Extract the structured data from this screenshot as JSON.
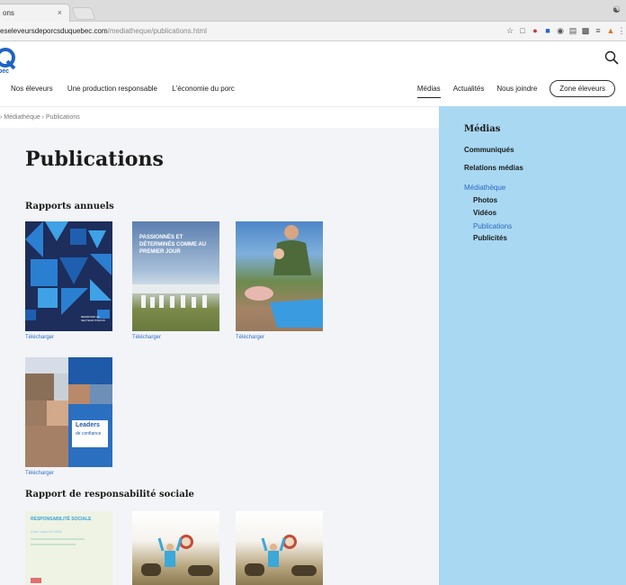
{
  "browser": {
    "tab_title": "ons",
    "tab_close": "×",
    "url_host": "eseleveursdeporcsduquebec.com",
    "url_path": "/mediatheque/publications.html"
  },
  "header": {
    "logo_text": "bec",
    "nav_left": [
      "Nos éleveurs",
      "Une production responsable",
      "L'économie du porc"
    ],
    "nav_right": [
      "Médias",
      "Actualités",
      "Nous joindre"
    ],
    "zone_button": "Zone éleveurs"
  },
  "breadcrumb": "› Médiathèque  ›  Publications",
  "main": {
    "title": "Publications",
    "section_annual": "Rapports annuels",
    "section_social": "Rapport de responsabilité sociale",
    "download_label": "Télécharger",
    "cover_texts": {
      "report1_small": "REDÉFINIR LE SECTEUR PORCIN",
      "report2_head": "PASSIONNÉS ET DÉTERMINÉS COMME AU PREMIER JOUR",
      "report4_head": "Leaders",
      "report4_sub": "de confiance",
      "social1_head": "RESPONSABILITÉ SOCIALE",
      "social1_sub": "Chez nous en 2016"
    }
  },
  "sidebar": {
    "title": "Médias",
    "items": [
      "Communiqués",
      "Relations médias",
      "Médiathèque"
    ],
    "subitems": [
      "Photos",
      "Vidéos",
      "Publications",
      "Publicités"
    ],
    "active": "Publications"
  },
  "colors": {
    "accent": "#2e6fc8",
    "sidebar_bg": "#a9d8f3",
    "cover_navy": "#1d2d5c"
  }
}
